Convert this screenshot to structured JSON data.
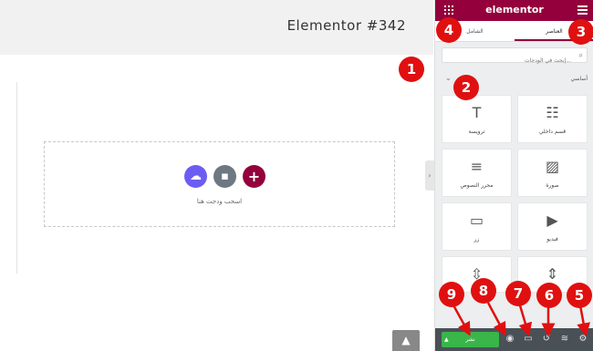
{
  "canvas": {
    "page_title": "Elementor #342",
    "drop_text": "اسحب ودجت هنا",
    "scroll_top_icon": "chevron-up-icon"
  },
  "panel": {
    "brand": "elementor",
    "tabs": [
      {
        "label": "الشامل"
      },
      {
        "label": "العناصر"
      }
    ],
    "search_placeholder": "إبحث في الودجات...",
    "section_title": "أساسي",
    "widgets": [
      {
        "label": "قسم داخلي",
        "icon": "inner-section-icon"
      },
      {
        "label": "ترويسة",
        "icon": "heading-icon"
      },
      {
        "label": "صورة",
        "icon": "image-icon"
      },
      {
        "label": "محرر النصوص",
        "icon": "text-editor-icon"
      },
      {
        "label": "فيديو",
        "icon": "video-icon"
      },
      {
        "label": "زر",
        "icon": "button-icon"
      }
    ],
    "publish_label": "نشر"
  },
  "annotations": [
    "1",
    "2",
    "3",
    "4",
    "5",
    "6",
    "7",
    "8",
    "9"
  ],
  "colors": {
    "brand": "#93003c",
    "publish": "#39b54a",
    "annotation": "#e01010",
    "footer": "#495157"
  }
}
